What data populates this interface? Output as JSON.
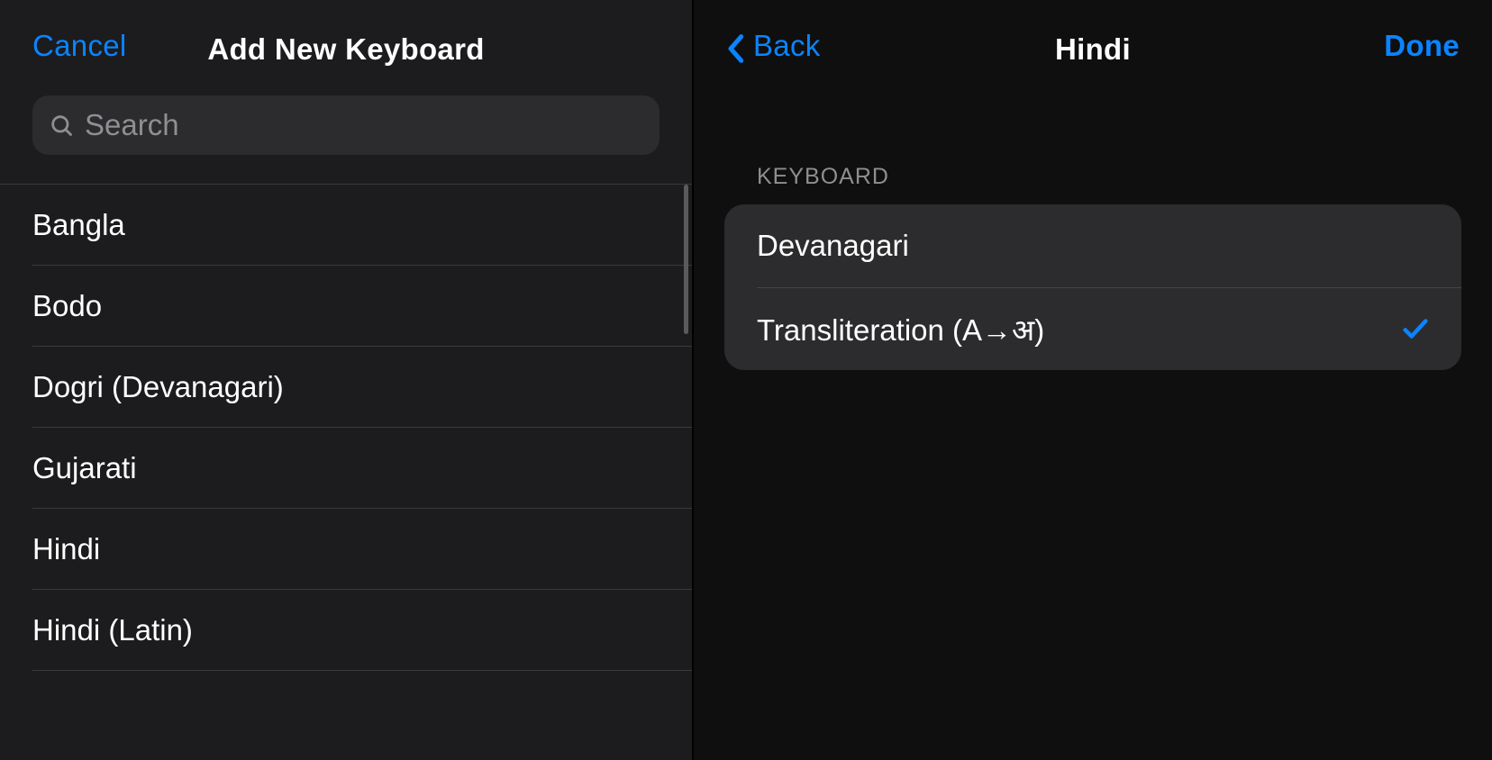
{
  "colors": {
    "accent": "#0a84ff",
    "sheet_bg": "#1c1c1e",
    "page_bg": "#0f0f0f",
    "cell_bg": "#2c2c2e",
    "separator": "#3a3a3c",
    "secondary_text": "#8e8e93"
  },
  "left": {
    "cancel": "Cancel",
    "title": "Add New Keyboard",
    "search_placeholder": "Search",
    "languages": [
      {
        "label": "Bangla"
      },
      {
        "label": "Bodo"
      },
      {
        "label": "Dogri (Devanagari)"
      },
      {
        "label": "Gujarati"
      },
      {
        "label": "Hindi"
      },
      {
        "label": "Hindi (Latin)"
      }
    ]
  },
  "right": {
    "back": "Back",
    "title": "Hindi",
    "done": "Done",
    "section": "KEYBOARD",
    "options": [
      {
        "label": "Devanagari",
        "selected": false
      },
      {
        "label": "Transliteration (A→अ)",
        "selected": true
      }
    ]
  }
}
